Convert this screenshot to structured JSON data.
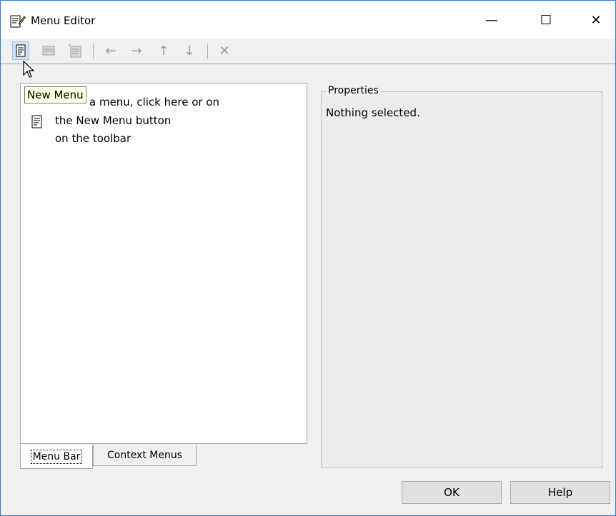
{
  "window": {
    "title": "Menu Editor",
    "minimize_glyph": "—",
    "maximize_glyph": "☐",
    "close_glyph": "✕"
  },
  "toolbar": {
    "buttons": [
      {
        "name": "new-menu",
        "icon": "new-menu-icon"
      },
      {
        "name": "new-menu-item",
        "icon": "new-menu-item-icon"
      },
      {
        "name": "new-context-menu",
        "icon": "new-context-menu-icon"
      },
      {
        "name": "move-left",
        "icon": "arrow-left-icon",
        "glyph": "←"
      },
      {
        "name": "move-right",
        "icon": "arrow-right-icon",
        "glyph": "→"
      },
      {
        "name": "move-up",
        "icon": "arrow-up-icon",
        "glyph": "↑"
      },
      {
        "name": "move-down",
        "icon": "arrow-down-icon",
        "glyph": "↓"
      },
      {
        "name": "delete",
        "icon": "delete-icon",
        "glyph": "✕"
      }
    ],
    "tooltip": "New Menu"
  },
  "menu_panel": {
    "hint_line1": "a menu, click here or on",
    "hint_line2": "the New Menu button",
    "hint_line3": "on the toolbar"
  },
  "tabs": {
    "menu_bar": "Menu Bar",
    "context_menus": "Context Menus"
  },
  "properties": {
    "legend": "Properties",
    "status": "Nothing selected."
  },
  "buttons": {
    "ok": "OK",
    "help": "Help"
  },
  "colors": {
    "window_border": "#2b79d8",
    "tooltip_bg": "#ffffe1",
    "active_button_bg": "#cce4f7"
  }
}
